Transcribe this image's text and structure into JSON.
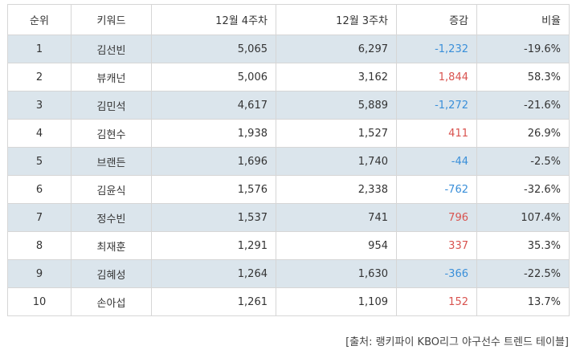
{
  "table": {
    "headers": {
      "rank": "순위",
      "keyword": "키워드",
      "week4": "12월 4주차",
      "week3": "12월 3주차",
      "change": "증감",
      "ratio": "비율"
    },
    "rows": [
      {
        "rank": "1",
        "keyword": "김선빈",
        "week4": "5,065",
        "week3": "6,297",
        "change": "-1,232",
        "ratio": "-19.6%"
      },
      {
        "rank": "2",
        "keyword": "뷰캐넌",
        "week4": "5,006",
        "week3": "3,162",
        "change": "1,844",
        "ratio": "58.3%"
      },
      {
        "rank": "3",
        "keyword": "김민석",
        "week4": "4,617",
        "week3": "5,889",
        "change": "-1,272",
        "ratio": "-21.6%"
      },
      {
        "rank": "4",
        "keyword": "김현수",
        "week4": "1,938",
        "week3": "1,527",
        "change": "411",
        "ratio": "26.9%"
      },
      {
        "rank": "5",
        "keyword": "브랜든",
        "week4": "1,696",
        "week3": "1,740",
        "change": "-44",
        "ratio": "-2.5%"
      },
      {
        "rank": "6",
        "keyword": "김윤식",
        "week4": "1,576",
        "week3": "2,338",
        "change": "-762",
        "ratio": "-32.6%"
      },
      {
        "rank": "7",
        "keyword": "정수빈",
        "week4": "1,537",
        "week3": "741",
        "change": "796",
        "ratio": "107.4%"
      },
      {
        "rank": "8",
        "keyword": "최재훈",
        "week4": "1,291",
        "week3": "954",
        "change": "337",
        "ratio": "35.3%"
      },
      {
        "rank": "9",
        "keyword": "김혜성",
        "week4": "1,264",
        "week3": "1,630",
        "change": "-366",
        "ratio": "-22.5%"
      },
      {
        "rank": "10",
        "keyword": "손아섭",
        "week4": "1,261",
        "week3": "1,109",
        "change": "152",
        "ratio": "13.7%"
      }
    ]
  },
  "source": "[출처: 랭키파이 KBO리그 야구선수 트렌드 테이블]",
  "colors": {
    "alt_row_bg": "#dbe5ec",
    "border": "#d6d6d6",
    "negative": "#3a8fd9",
    "positive": "#d9534f"
  }
}
